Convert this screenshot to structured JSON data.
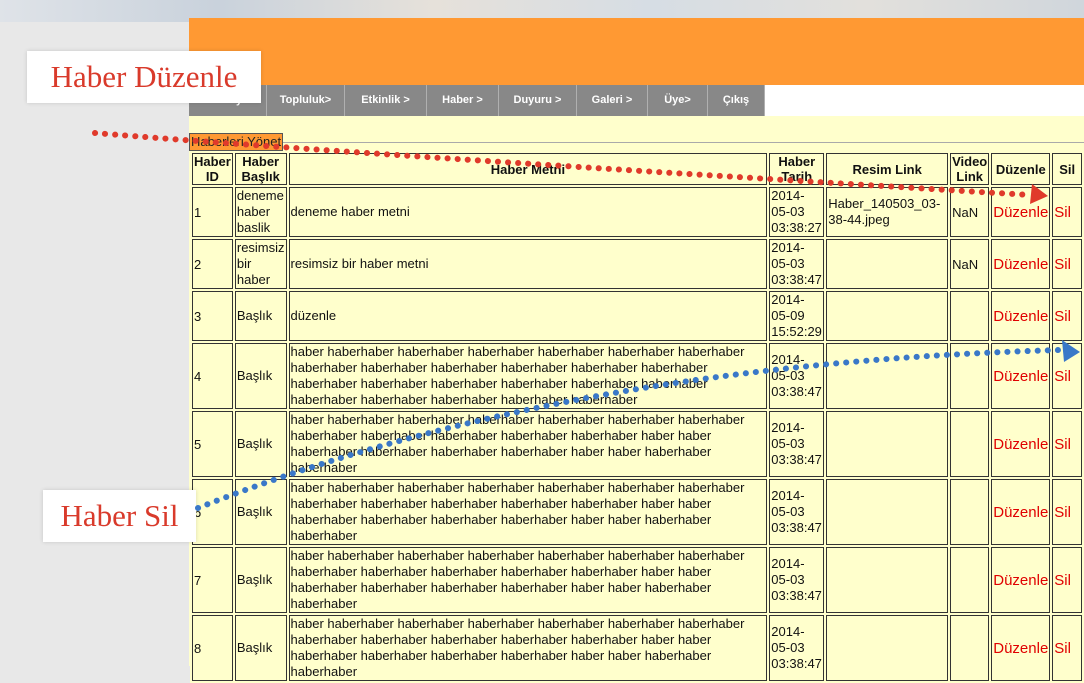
{
  "annotations": {
    "edit_label": "Haber Düzenle",
    "delete_label": "Haber Sil",
    "edit_color": "#e03a2b",
    "delete_color": "#3a78c8"
  },
  "nav": {
    "items": [
      "Anasayfa",
      "Topluluk>",
      "Etkinlik >",
      "Haber >",
      "Duyuru >",
      "Galeri >",
      "Üye>",
      "Çıkış"
    ]
  },
  "section": {
    "title": "Haberleri Yönet"
  },
  "table": {
    "headers": {
      "id": "Haber ID",
      "title": "Haber Başlık",
      "text": "Haber Metni",
      "date": "Haber Tarih",
      "image": "Resim Link",
      "video": "Video Link",
      "edit": "Düzenle",
      "delete": "Sil"
    },
    "rows": [
      {
        "id": "1",
        "title": "deneme haber baslik",
        "text": "deneme haber metni",
        "date": "2014-05-03 03:38:27",
        "image": "Haber_140503_03-38-44.jpeg",
        "video": "NaN",
        "edit": "Düzenle",
        "delete": "Sil"
      },
      {
        "id": "2",
        "title": "resimsiz bir haber",
        "text": "resimsiz bir haber metni",
        "date": "2014-05-03 03:38:47",
        "image": "",
        "video": "NaN",
        "edit": "Düzenle",
        "delete": "Sil"
      },
      {
        "id": "3",
        "title": "Başlık",
        "text": "düzenle",
        "date": "2014-05-09 15:52:29",
        "image": "",
        "video": "",
        "edit": "Düzenle",
        "delete": "Sil"
      },
      {
        "id": "4",
        "title": "Başlık",
        "text": "haber haberhaber haberhaber haberhaber haberhaber haberhaber haberhaber haberhaber haberhaber haberhaber haberhaber haberhaber haberhaber haberhaber haberhaber haberhaber haberhaber haberhaber haberhaber haberhaber haberhaber haberhaber haberhaber haberhaber",
        "date": "2014-05-03 03:38:47",
        "image": "",
        "video": "",
        "edit": "Düzenle",
        "delete": "Sil"
      },
      {
        "id": "5",
        "title": "Başlık",
        "text": "haber haberhaber haberhaber haberhaber haberhaber haberhaber haberhaber haberhaber haberhaber haberhaber haberhaber haberhaber haber haber haberhaber haberhaber haberhaber haberhaber haber haber haberhaber haberhaber",
        "date": "2014-05-03 03:38:47",
        "image": "",
        "video": "",
        "edit": "Düzenle",
        "delete": "Sil"
      },
      {
        "id": "6",
        "title": "Başlık",
        "text": "haber haberhaber haberhaber haberhaber haberhaber haberhaber haberhaber haberhaber haberhaber haberhaber haberhaber haberhaber haber haber haberhaber haberhaber haberhaber haberhaber haber haber haberhaber haberhaber",
        "date": "2014-05-03 03:38:47",
        "image": "",
        "video": "",
        "edit": "Düzenle",
        "delete": "Sil"
      },
      {
        "id": "7",
        "title": "Başlık",
        "text": "haber haberhaber haberhaber haberhaber haberhaber haberhaber haberhaber haberhaber haberhaber haberhaber haberhaber haberhaber haber haber haberhaber haberhaber haberhaber haberhaber haber haber haberhaber haberhaber",
        "date": "2014-05-03 03:38:47",
        "image": "",
        "video": "",
        "edit": "Düzenle",
        "delete": "Sil"
      },
      {
        "id": "8",
        "title": "Başlık",
        "text": "haber haberhaber haberhaber haberhaber haberhaber haberhaber haberhaber haberhaber haberhaber haberhaber haberhaber haberhaber haber haber haberhaber haberhaber haberhaber haberhaber haber haber haberhaber haberhaber",
        "date": "2014-05-03 03:38:47",
        "image": "",
        "video": "",
        "edit": "Düzenle",
        "delete": "Sil"
      }
    ]
  }
}
